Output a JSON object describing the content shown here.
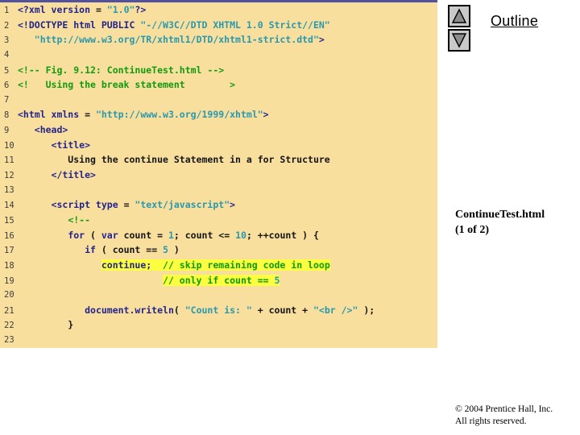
{
  "outline_panel": {
    "title": "Outline"
  },
  "reference": {
    "line1": "ContinueTest.html",
    "line2": "(1 of 2)"
  },
  "footer": {
    "line1": "© 2004 Prentice Hall, Inc.",
    "line2": "All rights reserved."
  },
  "code_listing": {
    "figure_caption": "Fig. 9.12: ContinueTest.html",
    "colors": {
      "panel_bg": "#F9DF9E",
      "panel_border": "#52529E",
      "keyword": "#23238E",
      "string": "#2898AC",
      "number": "#2898AC",
      "comment": "#0F9B0F",
      "plain": "#151515",
      "highlight": "#FBFF3F",
      "line_number": "#3E3E3E"
    },
    "lines": [
      {
        "n": 1,
        "seg": [
          {
            "t": "<?xml version",
            "c": "k"
          },
          {
            "t": " = ",
            "c": "p"
          },
          {
            "t": "\"1.0\"",
            "c": "s"
          },
          {
            "t": "?>",
            "c": "k"
          }
        ]
      },
      {
        "n": 2,
        "seg": [
          {
            "t": "<!DOCTYPE html PUBLIC ",
            "c": "k"
          },
          {
            "t": "\"-//W3C//DTD XHTML 1.0 Strict//EN\"",
            "c": "s"
          }
        ]
      },
      {
        "n": 3,
        "seg": [
          {
            "t": "   ",
            "c": "p"
          },
          {
            "t": "\"http://www.w3.org/TR/xhtml1/DTD/xhtml1-strict.dtd\"",
            "c": "s"
          },
          {
            "t": ">",
            "c": "k"
          }
        ]
      },
      {
        "n": 4,
        "seg": []
      },
      {
        "n": 5,
        "seg": [
          {
            "t": "<!-- Fig. 9.12: ContinueTest.html -->",
            "c": "c"
          }
        ]
      },
      {
        "n": 6,
        "seg": [
          {
            "t": "<!   Using the break statement        >",
            "c": "c"
          }
        ]
      },
      {
        "n": 7,
        "seg": []
      },
      {
        "n": 8,
        "seg": [
          {
            "t": "<html xmlns",
            "c": "k"
          },
          {
            "t": " = ",
            "c": "p"
          },
          {
            "t": "\"http://www.w3.org/1999/xhtml\"",
            "c": "s"
          },
          {
            "t": ">",
            "c": "k"
          }
        ]
      },
      {
        "n": 9,
        "seg": [
          {
            "t": "   ",
            "c": "p"
          },
          {
            "t": "<head>",
            "c": "k"
          }
        ]
      },
      {
        "n": 10,
        "seg": [
          {
            "t": "      ",
            "c": "p"
          },
          {
            "t": "<title>",
            "c": "k"
          }
        ]
      },
      {
        "n": 11,
        "seg": [
          {
            "t": "         Using the continue Statement in a for Structure",
            "c": "p"
          }
        ]
      },
      {
        "n": 12,
        "seg": [
          {
            "t": "      ",
            "c": "p"
          },
          {
            "t": "</title>",
            "c": "k"
          }
        ]
      },
      {
        "n": 13,
        "seg": []
      },
      {
        "n": 14,
        "seg": [
          {
            "t": "      ",
            "c": "p"
          },
          {
            "t": "<script type",
            "c": "k"
          },
          {
            "t": " = ",
            "c": "p"
          },
          {
            "t": "\"text/javascript\"",
            "c": "s"
          },
          {
            "t": ">",
            "c": "k"
          }
        ]
      },
      {
        "n": 15,
        "seg": [
          {
            "t": "         ",
            "c": "p"
          },
          {
            "t": "<!--",
            "c": "c"
          }
        ]
      },
      {
        "n": 16,
        "seg": [
          {
            "t": "         ",
            "c": "p"
          },
          {
            "t": "for",
            "c": "k"
          },
          {
            "t": " ( ",
            "c": "p"
          },
          {
            "t": "var",
            "c": "k"
          },
          {
            "t": " count = ",
            "c": "p"
          },
          {
            "t": "1",
            "c": "n"
          },
          {
            "t": "; count <= ",
            "c": "p"
          },
          {
            "t": "10",
            "c": "n"
          },
          {
            "t": "; ++count ) {",
            "c": "p"
          }
        ]
      },
      {
        "n": 17,
        "seg": [
          {
            "t": "            ",
            "c": "p"
          },
          {
            "t": "if",
            "c": "k"
          },
          {
            "t": " ( count == ",
            "c": "p"
          },
          {
            "t": "5",
            "c": "n"
          },
          {
            "t": " )",
            "c": "p"
          }
        ]
      },
      {
        "n": 18,
        "seg": [
          {
            "t": "               ",
            "c": "p"
          },
          {
            "t": "continue;",
            "c": "k",
            "h": true
          },
          {
            "t": "  ",
            "c": "p",
            "h": true
          },
          {
            "t": "// skip remaining code in loop",
            "c": "c",
            "h": true
          }
        ]
      },
      {
        "n": 19,
        "seg": [
          {
            "t": "                          ",
            "c": "p"
          },
          {
            "t": "// only if count == ",
            "c": "c",
            "h": true
          },
          {
            "t": "5",
            "c": "n",
            "h": true
          }
        ]
      },
      {
        "n": 20,
        "seg": []
      },
      {
        "n": 21,
        "seg": [
          {
            "t": "            ",
            "c": "p"
          },
          {
            "t": "document.writeln",
            "c": "k"
          },
          {
            "t": "( ",
            "c": "p"
          },
          {
            "t": "\"Count is: \"",
            "c": "s"
          },
          {
            "t": " + count + ",
            "c": "p"
          },
          {
            "t": "\"<br />\"",
            "c": "s"
          },
          {
            "t": " );",
            "c": "p"
          }
        ]
      },
      {
        "n": 22,
        "seg": [
          {
            "t": "         }",
            "c": "p"
          }
        ]
      },
      {
        "n": 23,
        "seg": []
      }
    ]
  }
}
